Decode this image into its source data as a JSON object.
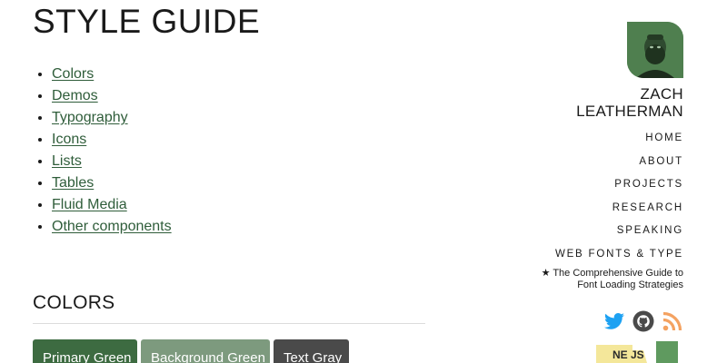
{
  "page": {
    "title": "STYLE GUIDE"
  },
  "toc": {
    "items": [
      {
        "label": "Colors"
      },
      {
        "label": "Demos"
      },
      {
        "label": "Typography"
      },
      {
        "label": "Icons"
      },
      {
        "label": "Lists"
      },
      {
        "label": "Tables"
      },
      {
        "label": "Fluid Media"
      },
      {
        "label": "Other components"
      }
    ]
  },
  "colors_section": {
    "title": "COLORS",
    "swatches": [
      {
        "label": "Primary Green",
        "color": "#3d6b41"
      },
      {
        "label": "Background Green",
        "color": "#7d9a7e"
      },
      {
        "label": "Text Gray",
        "color": "#4a4a4a"
      }
    ]
  },
  "sidebar": {
    "avatar_icon": "author-photo",
    "name_first": "ZACH",
    "name_last": "LEATHERMAN",
    "nav": [
      {
        "label": "HOME"
      },
      {
        "label": "ABOUT"
      },
      {
        "label": "PROJECTS"
      },
      {
        "label": "RESEARCH"
      },
      {
        "label": "SPEAKING"
      },
      {
        "label": "WEB FONTS & TYPE"
      }
    ],
    "featured_line1": "★ The Comprehensive Guide to",
    "featured_line2": "Font Loading Strategies",
    "social": [
      {
        "icon": "twitter-icon",
        "color": "#1da1f2"
      },
      {
        "icon": "github-icon",
        "color": "#4a4a4a"
      },
      {
        "icon": "rss-icon",
        "color": "#f4a261"
      }
    ],
    "badges": [
      {
        "icon": "nebraska-js-badge",
        "text": "NE JS"
      },
      {
        "icon": "nebraska-state-badge"
      }
    ]
  }
}
